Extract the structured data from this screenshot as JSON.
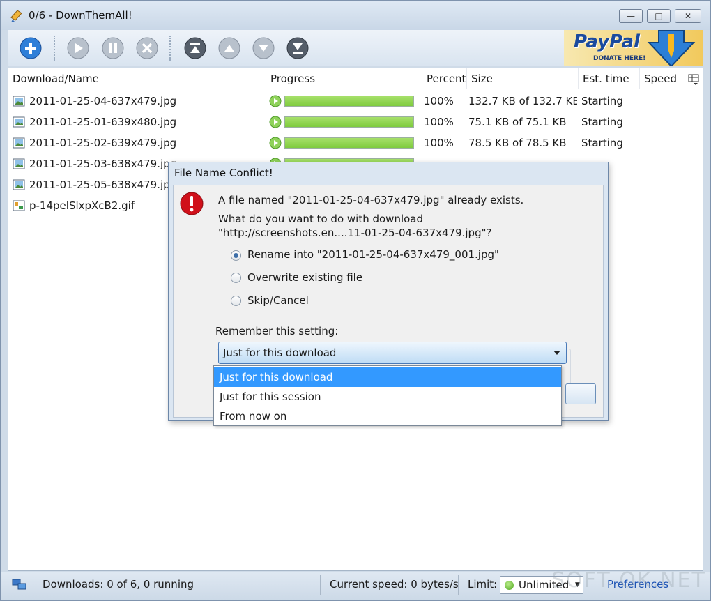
{
  "window": {
    "title": "0/6 - DownThemAll!",
    "controls": {
      "minimize": "—",
      "maximize": "□",
      "close": "✕"
    }
  },
  "toolbar": {
    "buttons": [
      "add-icon",
      "play-icon",
      "pause-icon",
      "cancel-icon",
      "move-top-icon",
      "move-up-icon",
      "move-down-icon",
      "move-bottom-icon"
    ],
    "paypal": {
      "word": "PayPal",
      "sub": "DONATE HERE!"
    }
  },
  "list": {
    "columns": [
      "Download/Name",
      "Progress",
      "Percent",
      "Size",
      "Est. time",
      "Speed"
    ],
    "rows": [
      {
        "name": "2011-01-25-04-637x479.jpg",
        "icon": "image-file-icon",
        "progress": 1.0,
        "percent": "100%",
        "size": "132.7 KB of 132.7 KB",
        "est": "Starting"
      },
      {
        "name": "2011-01-25-01-639x480.jpg",
        "icon": "image-file-icon",
        "progress": 1.0,
        "percent": "100%",
        "size": "75.1 KB of 75.1 KB",
        "est": "Starting"
      },
      {
        "name": "2011-01-25-02-639x479.jpg",
        "icon": "image-file-icon",
        "progress": 1.0,
        "percent": "100%",
        "size": "78.5 KB of 78.5 KB",
        "est": "Starting"
      },
      {
        "name": "2011-01-25-03-638x479.jpg",
        "icon": "image-file-icon",
        "progress": 1.0,
        "percent": "",
        "size": "",
        "est": ""
      },
      {
        "name": "2011-01-25-05-638x479.jpg",
        "icon": "image-file-icon",
        "progress": null,
        "percent": "",
        "size": "",
        "est": ""
      },
      {
        "name": "p-14pelSlxpXcB2.gif",
        "icon": "gif-file-icon",
        "progress": null,
        "percent": "",
        "size": "",
        "est": ""
      }
    ]
  },
  "dialog": {
    "title": "File Name Conflict!",
    "message_line1": "A file named \"2011-01-25-04-637x479.jpg\" already exists.",
    "message_line2": "What do you want to do with download",
    "message_line3": "\"http://screenshots.en....11-01-25-04-637x479.jpg\"?",
    "options": [
      {
        "label": "Rename into \"2011-01-25-04-637x479_001.jpg\"",
        "selected": true
      },
      {
        "label": "Overwrite existing file",
        "selected": false
      },
      {
        "label": "Skip/Cancel",
        "selected": false
      }
    ],
    "remember_label": "Remember this setting:",
    "remember_value": "Just for this download",
    "dropdown_options": [
      {
        "label": "Just for this download",
        "highlighted": true
      },
      {
        "label": "Just for this session",
        "highlighted": false
      },
      {
        "label": "From now on",
        "highlighted": false
      }
    ]
  },
  "status": {
    "downloads": "Downloads: 0 of 6, 0 running",
    "speed": "Current speed: 0 bytes/s",
    "limit_label": "Limit:",
    "limit_value": "Unlimited",
    "preferences": "Preferences",
    "watermark": "SOFT OK.NET"
  },
  "colors": {
    "progress_fill": "#7fcc3e",
    "selection": "#3399ff",
    "error_red": "#d0101a",
    "link": "#1f55b5"
  }
}
